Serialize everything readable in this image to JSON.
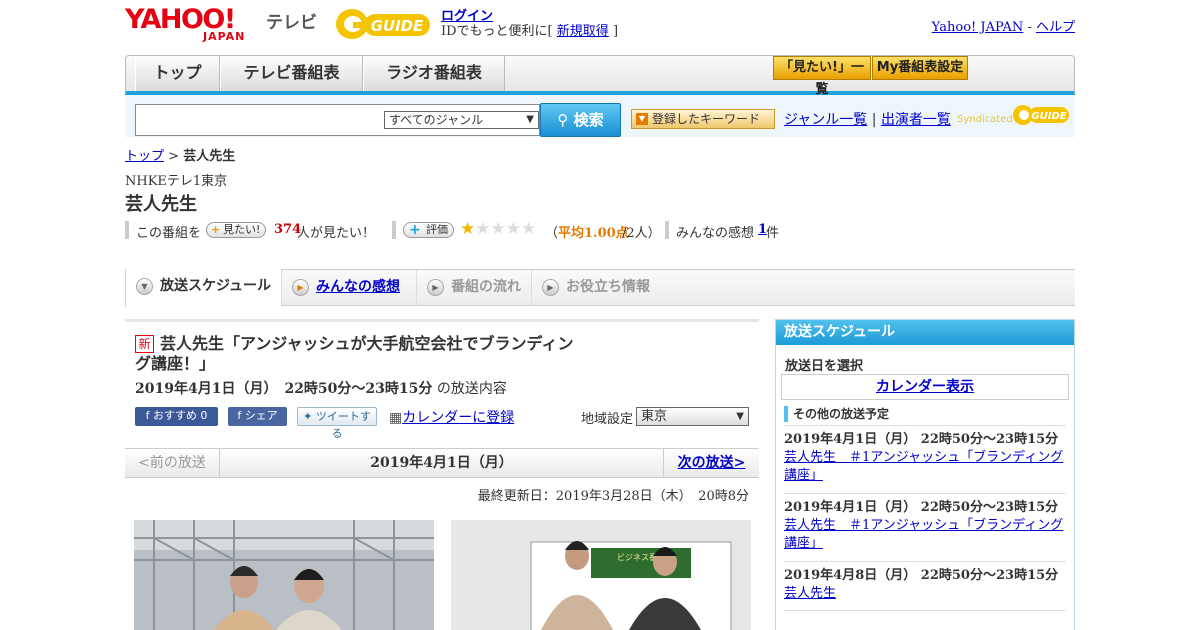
{
  "header": {
    "logo_text": "YAHOO!",
    "logo_sub": "JAPAN",
    "tv_label": "テレビ",
    "guide_logo": "G GUIDE",
    "login": "ログイン",
    "id_text": "IDでもっと便利に[",
    "signup": "新規取得",
    "id_close": "]",
    "yahoo_japan": "Yahoo! JAPAN",
    "separator": "-",
    "help": "ヘルプ"
  },
  "nav": {
    "tabs": [
      "トップ",
      "テレビ番組表",
      "ラジオ番組表"
    ],
    "want_list": "「見たい!」一覧",
    "my_guide": "My番組表設定"
  },
  "search": {
    "genre": "すべてのジャンル",
    "button": "検索",
    "keyword_button": "登録したキーワード",
    "genre_list": "ジャンル一覧",
    "divider": "|",
    "performer_list": "出演者一覧",
    "syndicated": "Syndicated"
  },
  "breadcrumb": {
    "top": "トップ",
    "sep": ">",
    "current": "芸人先生"
  },
  "program": {
    "channel": "NHKEテレ1東京",
    "title": "芸人先生",
    "want_prefix": "この番組を",
    "want_badge": "見たい!",
    "want_count": "374",
    "want_suffix": "人が見たい！",
    "rate_label": "評価",
    "rating": 1,
    "rating_max": 5,
    "avg_open": "（",
    "avg_text": "平均1.00点",
    "avg_count": "/2人）",
    "impressions_label": "みんなの感想",
    "impressions_count": "1",
    "impressions_unit": "件"
  },
  "tabs": [
    {
      "label": "放送スケジュール",
      "state": "active"
    },
    {
      "label": "みんなの感想",
      "state": "link"
    },
    {
      "label": "番組の流れ",
      "state": "disabled"
    },
    {
      "label": "お役立ち情報",
      "state": "disabled"
    }
  ],
  "episode": {
    "new_badge": "新",
    "title": "芸人先生「アンジャッシュが大手航空会社でブランディング講座！」",
    "date": "2019年4月1日（月）　22時50分～23時15分",
    "date_suffix": "の放送内容",
    "recommend": "おすすめ 0",
    "share": "シェア",
    "tweet": "ツイートする",
    "calendar": "カレンダーに登録",
    "region_label": "地域設定",
    "region": "東京"
  },
  "pager": {
    "prev": "<前の放送",
    "date": "2019年4月1日（月）",
    "next": "次の放送>"
  },
  "updated": "最終更新日：2019年3月28日（木）　20時8分",
  "sidebar": {
    "title": "放送スケジュール",
    "select_date": "放送日を選択",
    "calendar": "カレンダー表示",
    "other_title": "その他の放送予定",
    "items": [
      {
        "date": "2019年4月1日（月）  22時50分～23時15分",
        "title": "芸人先生　＃1アンジャッシュ「ブランディング講座」"
      },
      {
        "date": "2019年4月1日（月）  22時50分～23時15分",
        "title": "芸人先生　＃1アンジャッシュ「ブランディング講座」"
      },
      {
        "date": "2019年4月8日（月）  22時50分～23時15分",
        "title": "芸人先生"
      }
    ]
  },
  "photos": {
    "photo2_sign": "ビジネス番組"
  },
  "colors": {
    "accent_blue": "#1aa3dc",
    "yahoo_red": "#e60012",
    "link": "#0000cc",
    "rating_red": "#cc0000",
    "star": "#f2b600"
  }
}
